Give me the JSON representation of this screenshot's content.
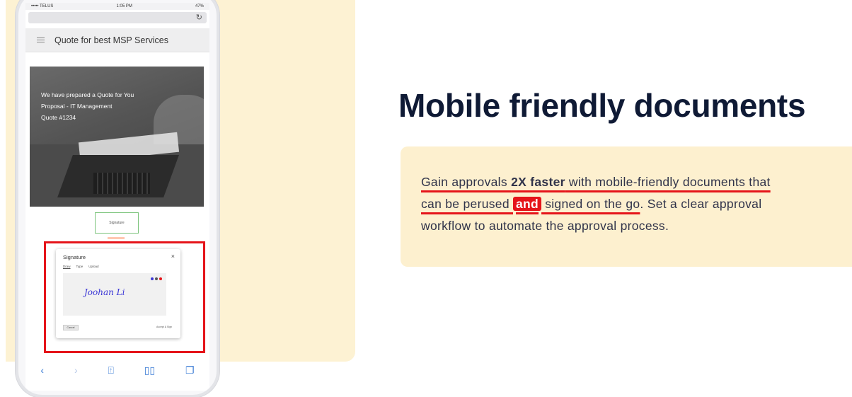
{
  "phone": {
    "status": {
      "carrier": "••••• TELUS",
      "time": "1:05 PM",
      "battery": "47%"
    },
    "doc_title": "Quote for best MSP Services",
    "hero_lines": [
      "We have prepared a Quote for You",
      "Proposal - IT Management",
      "Quote #1234"
    ],
    "signature_field_label": "Signature",
    "modal": {
      "title": "Signature",
      "tabs": [
        "Draw",
        "Type",
        "Upload"
      ],
      "signature": "Joohan Li",
      "cancel": "Cancel",
      "accept": "Accept & Sign"
    },
    "toolbar_icons": [
      "back-icon",
      "forward-icon",
      "share-icon",
      "bookmarks-icon",
      "tabs-icon"
    ]
  },
  "main": {
    "heading": "Mobile friendly documents",
    "callout": {
      "t1": "Gain approvals ",
      "t2": "2X faster",
      "t3": " with mobile-friendly documents that",
      "t4": "can be perused ",
      "t5": "and",
      "t6": " signed on the go",
      "t7": ". Set a clear approval",
      "t8": "workflow to automate the approval process."
    }
  },
  "colors": {
    "accent_red": "#e5141a",
    "callout_bg": "#fdf0cf",
    "heading": "#0f1a35"
  }
}
